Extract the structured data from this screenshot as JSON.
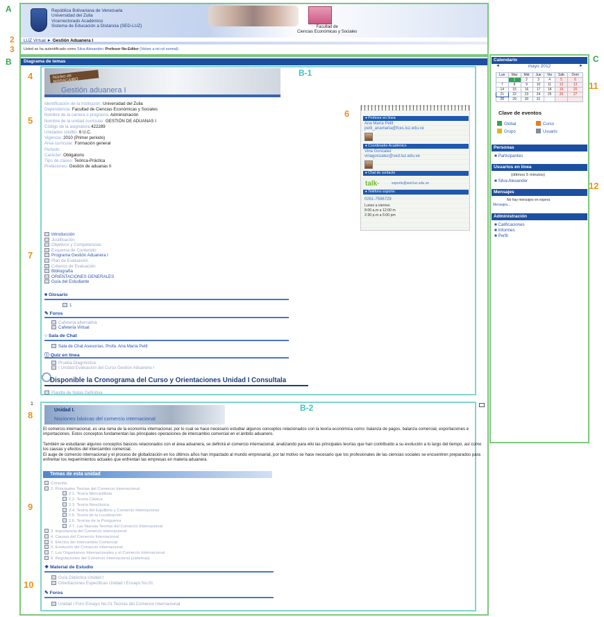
{
  "annotations": {
    "A": "A",
    "B": "B",
    "C": "C",
    "B1": "B-1",
    "B2": "B-2",
    "n1": "1",
    "n2": "2",
    "n3": "3",
    "n4": "4",
    "n5": "5",
    "n6": "6",
    "n7": "7",
    "n8": "8",
    "n9": "9",
    "n10": "10",
    "n11": "11",
    "n12": "12",
    "top_num": "1"
  },
  "header": {
    "line1": "República Bolivariana de Venezuela",
    "line2": "Universidad del Zulia",
    "line3": "Vicerrectorado Académico",
    "line4": "Sistema de Educación a Distancia (SED-LUZ)",
    "faculty1": "Facultad de",
    "faculty2": "Ciencias Económicas y Sociales"
  },
  "breadcrumb": {
    "home": "LUZ Virtual",
    "sep": "►",
    "current": "Gestión Aduanera I"
  },
  "login": {
    "prefix": "Usted se ha autentificado como",
    "user": "Silva Alexander",
    "role": ": Profesor No-Editor",
    "back": "(Volver a mi rol normal)"
  },
  "topics_header": "Diagrama de temas",
  "banner1": {
    "sign": "Núcleo de MARACAIBO",
    "title": "Gestión aduanera I"
  },
  "info": [
    {
      "k": "Identificación de la institución:",
      "v": " Universidad del Zulia"
    },
    {
      "k": "Dependencia:",
      "v": " Facultad de Ciencias Económicas y Sociales"
    },
    {
      "k": "Nombre de la carrera o programa:",
      "v": " Administración"
    },
    {
      "k": "Nombre de la unidad curricular:",
      "v": " GESTIÓN DE ADUANAS I"
    },
    {
      "k": "Código de la asignatura:",
      "v": "422289"
    },
    {
      "k": "Unidades crédito:",
      "v": " 6 U.C."
    },
    {
      "k": "Vigencia:",
      "v": " 2010 (Primer periodo)"
    },
    {
      "k": "Área curricular:",
      "v": " Formación general"
    },
    {
      "k": "Periodo:",
      "v": ""
    },
    {
      "k": "Carácter:",
      "v": " Obligatorio"
    },
    {
      "k": "Tipo de clases:",
      "v": " Teórica-Práctica"
    },
    {
      "k": "Prelaciones:",
      "v": " Gestión de aduanas II"
    }
  ],
  "notepad": {
    "s1": "♦ Profesor en línea",
    "prof": "Ana María Petit",
    "prof_mail": "petit_anamaria@fces.luz.edu.ve",
    "s2": "♦ Coordinador Académico",
    "coord": "Viria Gonzalez",
    "coord_mail": "viriagonzalez@sed.luz.edu.ve",
    "s3": "♦ Chat de contacto",
    "talk1": "talk",
    "talk2": "·",
    "talk_mail": "soporte@sed.luz.edu.ve",
    "s4": "♦ Teléfono soporte:",
    "phone": "0261-7596729",
    "h1": "Lunes a viernes",
    "h2": "8:00 a.m a 12:00 m",
    "h3": "2:30 p.m a 5:00 pm"
  },
  "resources": [
    {
      "label": "Introducción",
      "on": true
    },
    {
      "label": "Justificación",
      "on": false
    },
    {
      "label": "Objetivos y Competencias",
      "on": false
    },
    {
      "label": "Esquema de Contenido",
      "on": false
    },
    {
      "label": "Programa Gestión Aduanera I",
      "on": true
    },
    {
      "label": "Plan de Evaluación",
      "on": false
    },
    {
      "label": "Criterios de Evaluación",
      "on": false
    },
    {
      "label": "Bibliografía",
      "on": true
    },
    {
      "label": "ORIENTACIONES GENERALES",
      "on": true
    },
    {
      "label": "Guía del Estudiante",
      "on": true
    }
  ],
  "glosario": "Glosario",
  "glosario_count": "1",
  "foros": "Foros",
  "foros_items": [
    "Cafetería alternativa",
    "Cafetería Virtual"
  ],
  "chat": "Sala de Chat",
  "chat_item": "Sala de Chat Asesorías. Profa. Ana María Petit",
  "quiz": "Quiz en línea",
  "quiz_items": [
    "Prueba Diagnóstica",
    "I Unidad Evaluación del Curso Gestion Aduanera I"
  ],
  "big_link": "Disponible la Cronograma del Curso y Orientaciones Unidad I Consultala",
  "planilla": "Planilla de Notas Definitiva",
  "unit": {
    "t1": "Unidad I.",
    "t2": "Nociones básicas del comercio internacional",
    "p1": "El comercio internacional, es una rama de la economía internacional, por lo cual se hace necesario estudiar algunos conceptos relacionados con la teoría económica como: balanza de pagos, balanza comercial, exportaciones e importaciones. Estos conceptos fundamentan las principales operaciones de intercambio comercial en el ámbito aduanero.",
    "p2": "También se estudiaran algunos conceptos básicos relacionados con el área aduanera, se definirá el comercio internacional, analizando para ello las principales teorías que han contribuido a su evolución a lo largo del tiempo, así como los causas y efectos del intercambio comercial.",
    "p3": "El auge de comercio internacional y el proceso de globalización en los últimos años han impactado al mundo empresarial, por tal motivo se hace necesario que los profesionales de las ciencias sociales se encuentren preparados para enfrentar los requerimientos actuales que enfrentan las empresas en materia aduanera."
  },
  "temas_header": "Temas de esta unidad",
  "temas": [
    {
      "label": "Consulta",
      "indent": 0,
      "q": true
    },
    {
      "label": "2. Principales Teorías del Comercio Internacional",
      "indent": 0
    },
    {
      "label": "2.1. Teoría Mercantilista",
      "indent": 1
    },
    {
      "label": "2.2. Teoría Clásica",
      "indent": 1
    },
    {
      "label": "2.3. Teoría Neoclásica",
      "indent": 1
    },
    {
      "label": "2.4. Teoría del Equilibrio y Comercio Internacional",
      "indent": 1
    },
    {
      "label": "2.5. Teoría de la Localización",
      "indent": 1
    },
    {
      "label": "2.6. Teorías de la Postguerra",
      "indent": 1
    },
    {
      "label": "2.7. Las Nuevas Teorías del Comercio Internacional",
      "indent": 1
    },
    {
      "label": "3. Importancia del Comercio Internacional",
      "indent": 0
    },
    {
      "label": "4. Causas del Comercio Internacional",
      "indent": 0
    },
    {
      "label": "5. Efectos del Intercambio Comercial",
      "indent": 0
    },
    {
      "label": "6. Evolución del Comercio Internacional",
      "indent": 0
    },
    {
      "label": "7. Los Organismos Internacionales y el Comercio Internacional",
      "indent": 0
    },
    {
      "label": "8. Regulaciones del Comercio Internacional (sistemas)",
      "indent": 0
    }
  ],
  "material": "Material de Estudio",
  "material_items": [
    "Guía Didáctica Unidad I",
    "Orientaciones Especificas Unidad I Ensayo No.01"
  ],
  "foros2": "Foros",
  "foros2_item": "Unidad I Foro Ensayo No.01 Teorías del Comercio Internacional",
  "calendar": {
    "header": "Calendario",
    "month": "mayo 2012",
    "prev": "◄",
    "next": "►",
    "days": [
      "Lun",
      "Mar",
      "Mié",
      "Jue",
      "Vie",
      "Sáb",
      "Dom"
    ],
    "weeks": [
      [
        "",
        "1",
        "2",
        "3",
        "4",
        "5",
        "6"
      ],
      [
        "7",
        "8",
        "9",
        "10",
        "11",
        "12",
        "13"
      ],
      [
        "14",
        "15",
        "16",
        "17",
        "18",
        "19",
        "20"
      ],
      [
        "21",
        "22",
        "23",
        "24",
        "25",
        "26",
        "27"
      ],
      [
        "28",
        "29",
        "30",
        "31",
        "",
        "",
        ""
      ]
    ],
    "today": "1",
    "current": "21"
  },
  "clave": "Clave de eventos",
  "events": [
    {
      "label": "Global",
      "color": "#2ea44f"
    },
    {
      "label": "Curso",
      "color": "#e67e22"
    },
    {
      "label": "Grupo",
      "color": "#e3b31f"
    },
    {
      "label": "Usuario",
      "color": "#7f8c9d"
    }
  ],
  "personas": {
    "header": "Personas",
    "link": "Participantes"
  },
  "online": {
    "header": "Usuarios en línea",
    "note": "(últimos 5 minutos)",
    "user": "Silva Alexander"
  },
  "mensajes": {
    "header": "Mensajes",
    "note": "No hay mensajes en espera",
    "link": "Mensajes..."
  },
  "admin": {
    "header": "Administración",
    "items": [
      "Calificaciones",
      "Informes",
      "Perfil"
    ]
  }
}
